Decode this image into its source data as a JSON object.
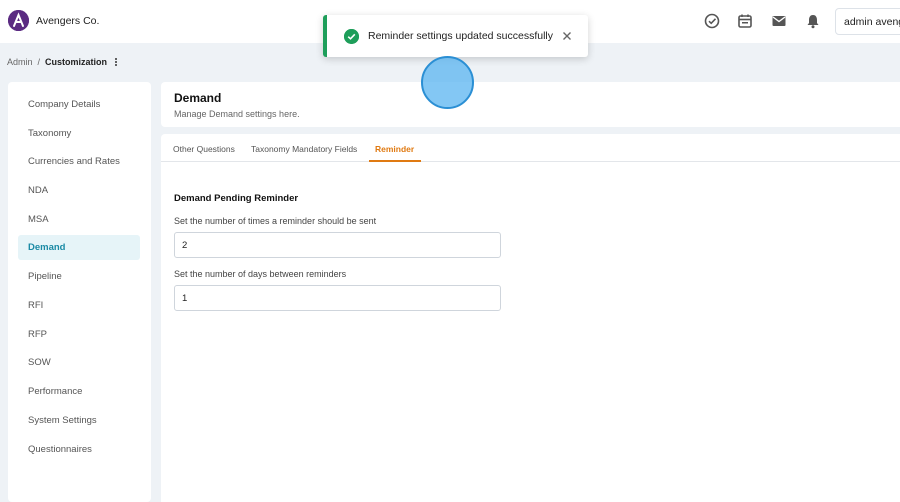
{
  "app": {
    "brand": "Avengers Co.",
    "user": "admin avengers"
  },
  "header_icons": [
    "check-circle-icon",
    "calendar-icon",
    "mail-icon",
    "bell-icon"
  ],
  "breadcrumb": {
    "root": "Admin",
    "separator": "/",
    "current": "Customization"
  },
  "sidebar": {
    "items": [
      {
        "label": "Company Details",
        "active": false
      },
      {
        "label": "Taxonomy",
        "active": false
      },
      {
        "label": "Currencies and Rates",
        "active": false
      },
      {
        "label": "NDA",
        "active": false
      },
      {
        "label": "MSA",
        "active": false
      },
      {
        "label": "Demand",
        "active": true
      },
      {
        "label": "Pipeline",
        "active": false
      },
      {
        "label": "RFI",
        "active": false
      },
      {
        "label": "RFP",
        "active": false
      },
      {
        "label": "SOW",
        "active": false
      },
      {
        "label": "Performance",
        "active": false
      },
      {
        "label": "System Settings",
        "active": false
      },
      {
        "label": "Questionnaires",
        "active": false
      }
    ]
  },
  "panel": {
    "title": "Demand",
    "subtitle": "Manage Demand settings here."
  },
  "tabs": [
    {
      "label": "Other Questions",
      "active": false
    },
    {
      "label": "Taxonomy Mandatory Fields",
      "active": false
    },
    {
      "label": "Reminder",
      "active": true
    }
  ],
  "reminder": {
    "section_title": "Demand Pending Reminder",
    "times_label": "Set the number of times a reminder should be sent",
    "times_value": "2",
    "days_label": "Set the number of days between reminders",
    "days_value": "1"
  },
  "toast": {
    "message": "Reminder settings updated successfully"
  },
  "colors": {
    "accent": "#e07a12",
    "active_nav": "#1a8aa5",
    "success": "#1e9e5a",
    "brand": "#5b2b82"
  }
}
